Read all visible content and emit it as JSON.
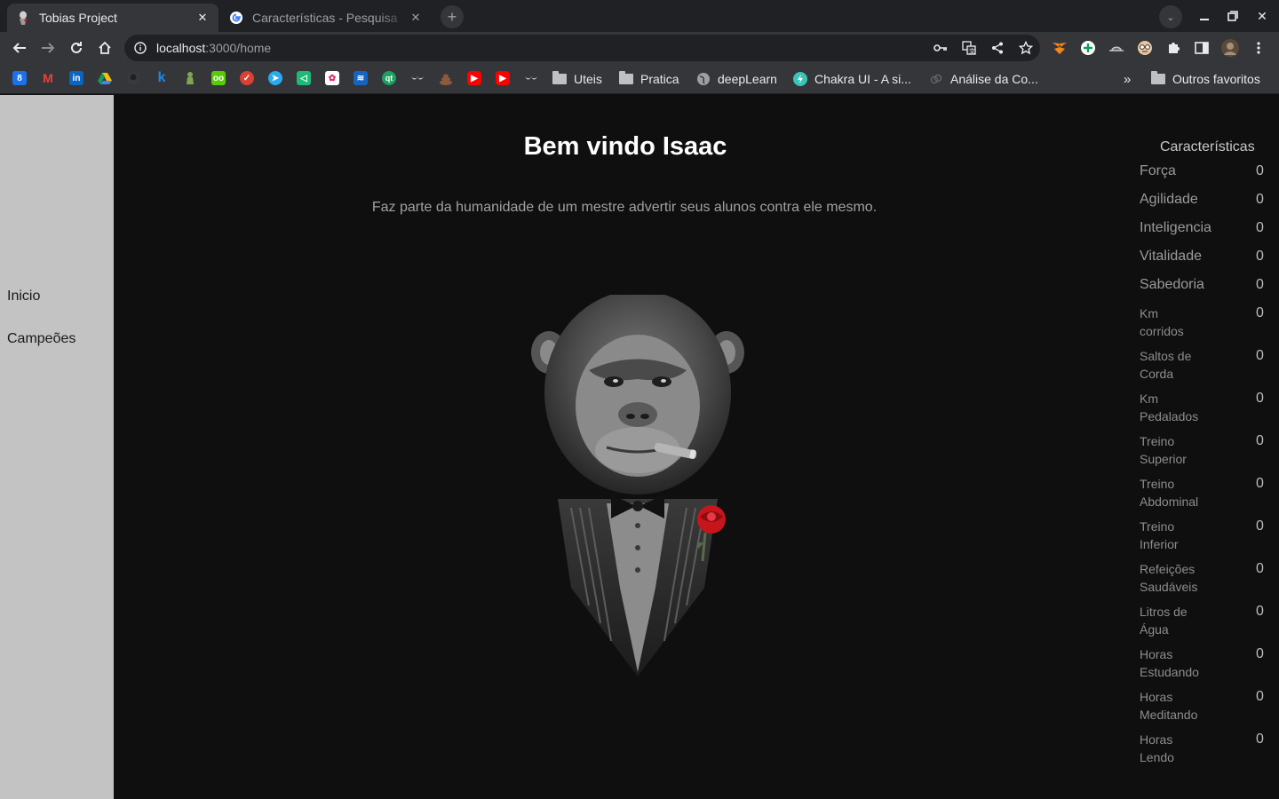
{
  "browser": {
    "tabs": [
      {
        "title": "Tobias Project",
        "active": true
      },
      {
        "title": "Características - Pesquisa",
        "active": false
      }
    ],
    "address": {
      "host": "localhost",
      "rest": ":3000/home"
    },
    "bookmarks": {
      "folders": [
        "Uteis",
        "Pratica",
        "deepLearn",
        "Chakra UI - A si...",
        "Análise da Co..."
      ],
      "overflow": "»",
      "other": "Outros favoritos"
    }
  },
  "sidebar": {
    "items": [
      "Inicio",
      "Campeões"
    ]
  },
  "main": {
    "title": "Bem vindo Isaac",
    "quote": "Faz parte da humanidade de um mestre advertir seus alunos contra ele mesmo."
  },
  "stats": {
    "title": "Características",
    "items": [
      {
        "label": "Força",
        "value": "0"
      },
      {
        "label": "Agilidade",
        "value": "0"
      },
      {
        "label": "Inteligencia",
        "value": "0"
      },
      {
        "label": "Vitalidade",
        "value": "0"
      },
      {
        "label": "Sabedoria",
        "value": "0"
      },
      {
        "label_lines": [
          "Km",
          "corridos"
        ],
        "value": "0"
      },
      {
        "label_lines": [
          "Saltos de",
          "Corda"
        ],
        "value": "0"
      },
      {
        "label_lines": [
          "Km",
          "Pedalados"
        ],
        "value": "0"
      },
      {
        "label_lines": [
          "Treino",
          "Superior"
        ],
        "value": "0"
      },
      {
        "label_lines": [
          "Treino",
          "Abdominal"
        ],
        "value": "0"
      },
      {
        "label_lines": [
          "Treino",
          "Inferior"
        ],
        "value": "0"
      },
      {
        "label_lines": [
          "Refeições",
          "Saudáveis"
        ],
        "value": "0"
      },
      {
        "label_lines": [
          "Litros de",
          "Água"
        ],
        "value": "0"
      },
      {
        "label_lines": [
          "Horas",
          "Estudando"
        ],
        "value": "0"
      },
      {
        "label_lines": [
          "Horas",
          "Meditando"
        ],
        "value": "0"
      },
      {
        "label_lines": [
          "Horas",
          "Lendo"
        ],
        "value": "0"
      }
    ]
  },
  "colors": {
    "page_bg": "#0f0f10",
    "sidebar_bg": "#c3c3c3",
    "rose": "#c8141b"
  }
}
